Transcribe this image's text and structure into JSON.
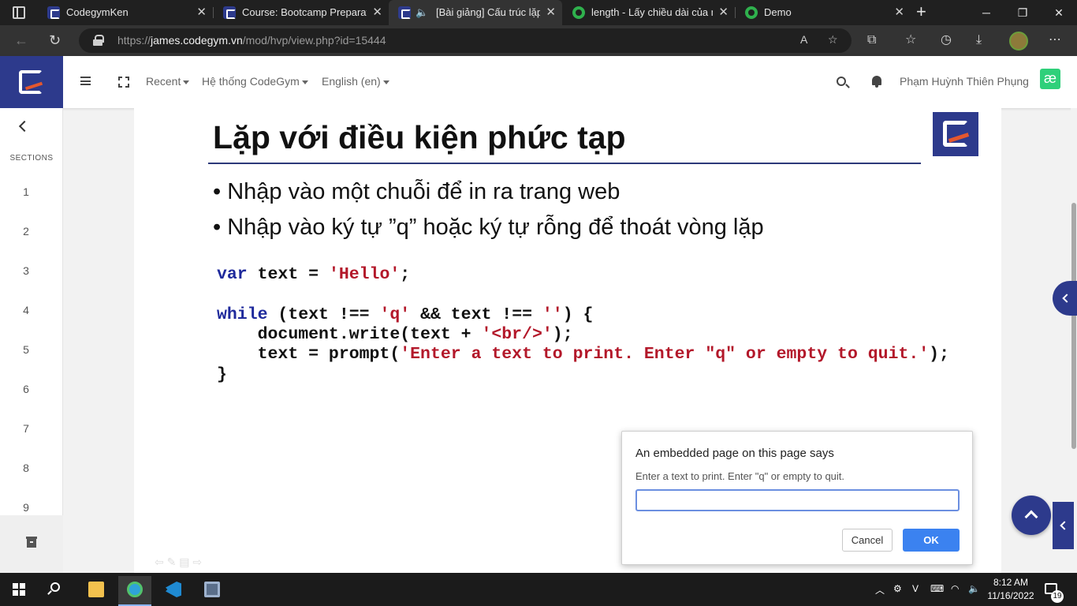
{
  "browser": {
    "tabs": [
      {
        "title": "CodegymKen",
        "active": false
      },
      {
        "title": "Course: Bootcamp Preparatio",
        "active": false
      },
      {
        "title": "[Bài giảng] Cấu trúc lặp",
        "active": true
      },
      {
        "title": "length - Lấy chiều dài của mả",
        "active": false
      },
      {
        "title": "Demo",
        "active": false
      }
    ],
    "url_scheme": "https://",
    "url_host": "james.codegym.vn",
    "url_path": "/mod/hvp/view.php?id=15444"
  },
  "navbar": {
    "recent": "Recent",
    "system": "Hệ thống CodeGym",
    "language": "English (en)",
    "user_name": "Phạm Huỳnh Thiên Phụng",
    "badge": "æ"
  },
  "sidebar": {
    "sections_label": "SECTIONS",
    "items": [
      "1",
      "2",
      "3",
      "4",
      "5",
      "6",
      "7",
      "8",
      "9"
    ]
  },
  "slide": {
    "title": "Lặp với điều kiện phức tạp",
    "bullets": [
      "• Nhập vào một chuỗi để in ra trang web",
      "• Nhập vào ký tự ”q” hoặc ký tự rỗng để thoát vòng lặp"
    ],
    "code": {
      "l1_kw": "var",
      "l1_rest": " text = ",
      "l1_str": "'Hello'",
      "l1_end": ";",
      "l2_kw": "while",
      "l2_a": " (text !== ",
      "l2_s1": "'q'",
      "l2_b": " && text !== ",
      "l2_s2": "''",
      "l2_c": ") {",
      "l3_a": "    document.write(text + ",
      "l3_s": "'<br/>'",
      "l3_b": ");",
      "l4_a": "    text = prompt(",
      "l4_s": "'Enter a text to print. Enter \"q\" or empty to quit.'",
      "l4_b": ");",
      "l5": "}"
    }
  },
  "dialog": {
    "title": "An embedded page on this page says",
    "message": "Enter a text to print. Enter \"q\" or empty to quit.",
    "input_value": "",
    "cancel_label": "Cancel",
    "ok_label": "OK"
  },
  "taskbar": {
    "time": "8:12 AM",
    "date": "11/16/2022",
    "notifications": "19"
  },
  "colors": {
    "brand": "#2d3a8c",
    "accent_orange": "#e4572e",
    "keyword": "#1f2a9c",
    "string": "#b3182a",
    "ok_button": "#3b82f0"
  }
}
